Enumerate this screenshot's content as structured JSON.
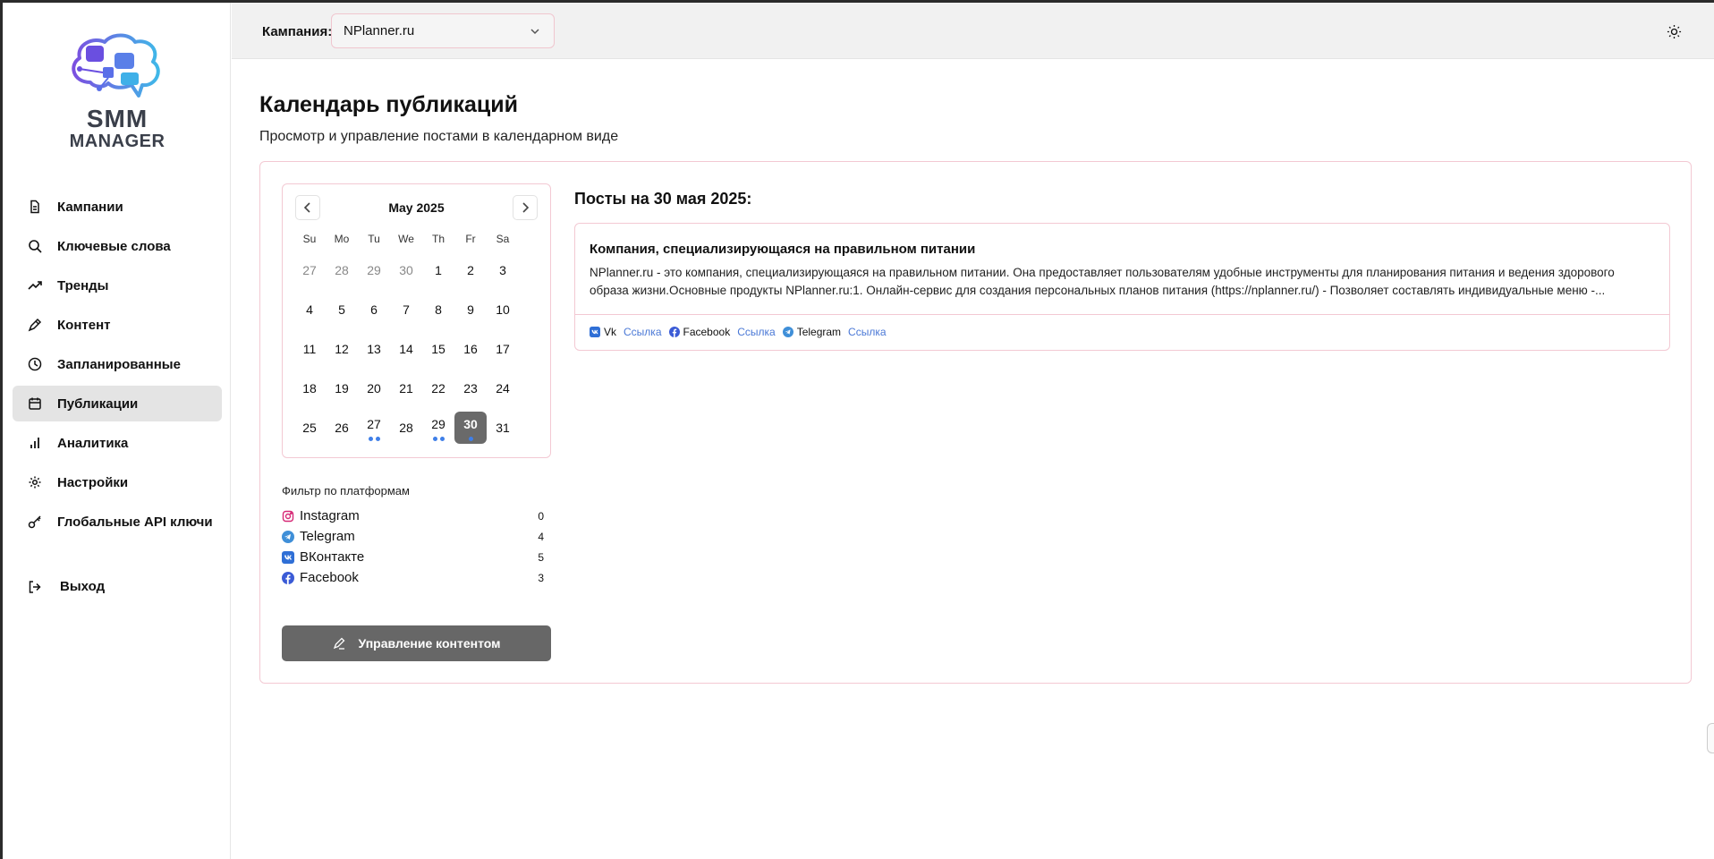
{
  "brand": {
    "line1": "SMM",
    "line2": "MANAGER"
  },
  "sidebar": {
    "items": [
      {
        "label": "Кампании",
        "icon": "document-icon"
      },
      {
        "label": "Ключевые слова",
        "icon": "search-icon"
      },
      {
        "label": "Тренды",
        "icon": "trend-icon"
      },
      {
        "label": "Контент",
        "icon": "pen-icon"
      },
      {
        "label": "Запланированные",
        "icon": "clock-icon"
      },
      {
        "label": "Публикации",
        "icon": "calendar-icon",
        "active": true
      },
      {
        "label": "Аналитика",
        "icon": "bar-chart-icon"
      },
      {
        "label": "Настройки",
        "icon": "gear-icon"
      },
      {
        "label": "Глобальные API ключи",
        "icon": "key-icon"
      }
    ],
    "logout_label": "Выход"
  },
  "topbar": {
    "campaign_label": "Кампания:",
    "campaign_value": "NPlanner.ru"
  },
  "page": {
    "title": "Календарь публикаций",
    "subtitle": "Просмотр и управление постами в календарном виде"
  },
  "calendar": {
    "month_label": "May 2025",
    "weekdays": [
      "Su",
      "Mo",
      "Tu",
      "We",
      "Th",
      "Fr",
      "Sa"
    ],
    "weeks": [
      [
        {
          "d": "27",
          "muted": true
        },
        {
          "d": "28",
          "muted": true
        },
        {
          "d": "29",
          "muted": true
        },
        {
          "d": "30",
          "muted": true
        },
        {
          "d": "1"
        },
        {
          "d": "2"
        },
        {
          "d": "3"
        }
      ],
      [
        {
          "d": "4"
        },
        {
          "d": "5"
        },
        {
          "d": "6"
        },
        {
          "d": "7"
        },
        {
          "d": "8"
        },
        {
          "d": "9"
        },
        {
          "d": "10"
        }
      ],
      [
        {
          "d": "11"
        },
        {
          "d": "12"
        },
        {
          "d": "13"
        },
        {
          "d": "14"
        },
        {
          "d": "15"
        },
        {
          "d": "16"
        },
        {
          "d": "17"
        }
      ],
      [
        {
          "d": "18"
        },
        {
          "d": "19"
        },
        {
          "d": "20"
        },
        {
          "d": "21"
        },
        {
          "d": "22"
        },
        {
          "d": "23"
        },
        {
          "d": "24"
        }
      ],
      [
        {
          "d": "25"
        },
        {
          "d": "26"
        },
        {
          "d": "27",
          "dots": 2
        },
        {
          "d": "28"
        },
        {
          "d": "29",
          "dots": 2
        },
        {
          "d": "30",
          "dots": 1,
          "selected": true
        },
        {
          "d": "31"
        }
      ]
    ],
    "dot_color": "#3f7fe8",
    "selected_color": "#6a6a6a"
  },
  "filter": {
    "title": "Фильтр по платформам",
    "platforms": [
      {
        "name": "Instagram",
        "count": "0",
        "icon": "instagram-icon",
        "color": "#d62976"
      },
      {
        "name": "Telegram",
        "count": "4",
        "icon": "telegram-icon",
        "color": "#3f8fd8"
      },
      {
        "name": "ВКонтакте",
        "count": "5",
        "icon": "vk-icon",
        "color": "#2f6fd6"
      },
      {
        "name": "Facebook",
        "count": "3",
        "icon": "facebook-icon",
        "color": "#3b5bd6"
      }
    ]
  },
  "manage_button": {
    "label": "Управление контентом"
  },
  "posts": {
    "heading": "Посты на 30 мая 2025:",
    "items": [
      {
        "title": "Компания, специализирующаяся на правильном питании",
        "text": "NPlanner.ru - это компания, специализирующаяся на правильном питании. Она предоставляет пользователям удобные инструменты для планирования питания и ведения здорового образа жизни.Основные продукты NPlanner.ru:1. Онлайн-сервис для создания персональных планов питания (https://nplanner.ru/) - Позволяет составлять индивидуальные меню -...",
        "links": [
          {
            "platform": "Vk",
            "link_label": "Ссылка",
            "icon": "vk-icon"
          },
          {
            "platform": "Facebook",
            "link_label": "Ссылка",
            "icon": "facebook-icon"
          },
          {
            "platform": "Telegram",
            "link_label": "Ссылка",
            "icon": "telegram-icon"
          }
        ]
      }
    ]
  },
  "colors": {
    "accent_border": "#f3c9d3",
    "link": "#4a78d6",
    "button": "#676767"
  }
}
